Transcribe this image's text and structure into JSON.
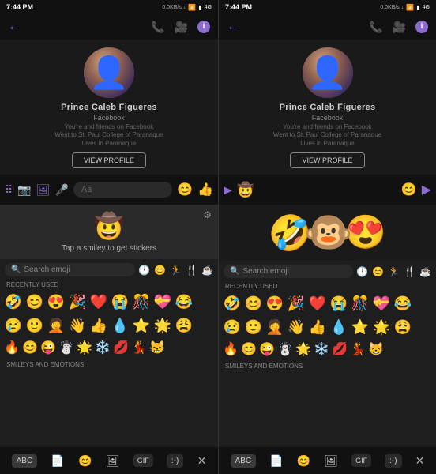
{
  "panels": [
    {
      "id": "left",
      "status_bar": {
        "time": "7:44 PM",
        "signal": "📶",
        "wifi": "WiFi",
        "battery": "4G",
        "data_speed": "0.0KB/s ↓"
      },
      "profile": {
        "name": "Prince Caleb Figueres",
        "source": "Facebook",
        "info_line1": "You're and friends on Facebook",
        "info_line2": "Went to St. Paul College of Paranaque",
        "info_line3": "Lives in Paranaque",
        "view_profile_label": "VIEW PROFILE"
      },
      "toolbar": {
        "placeholder": "Aa"
      },
      "sticker": {
        "text": "Tap a smiley to get stickers"
      },
      "emoji_keyboard": {
        "search_placeholder": "Search emoji",
        "recently_used_label": "RECENTLY USED",
        "emojis_row1": [
          "🤣",
          "😊",
          "😍",
          "🎉",
          "❤",
          "😭"
        ],
        "emojis_row2": [
          "😢",
          "🙂",
          "🤦",
          "👋",
          "👍",
          "💧"
        ],
        "emojis_row3": [
          "🔥",
          "😊",
          "😜",
          "☃",
          "🌟",
          "❄",
          "💋"
        ],
        "keyboard_buttons": [
          "ABC",
          "📄",
          "😊",
          "🖼",
          "GIF",
          ":-)",
          "✕"
        ]
      }
    },
    {
      "id": "right",
      "status_bar": {
        "time": "7:44 PM",
        "data_speed": "0.0KB/s ↓"
      },
      "profile": {
        "name": "Prince Caleb Figueres",
        "source": "Facebook",
        "info_line1": "You're and friends on Facebook",
        "info_line2": "Went to St. Paul College of Paranaque",
        "info_line3": "Lives in Paranaque",
        "view_profile_label": "VIEW PROFILE"
      },
      "big_emojis": [
        "🤣",
        "🐵",
        "😍"
      ],
      "emoji_keyboard": {
        "search_placeholder": "Search emoji",
        "recently_used_label": "RECENTLY USED",
        "emojis_row1": [
          "🤣",
          "😊",
          "😍",
          "🎉",
          "❤",
          "😭"
        ],
        "emojis_row2": [
          "😢",
          "🙂",
          "🤦",
          "👋",
          "👍",
          "💧"
        ],
        "emojis_row3": [
          "🔥",
          "😊",
          "😜",
          "☃",
          "🌟",
          "❄",
          "💋"
        ],
        "keyboard_buttons": [
          "ABC",
          "📄",
          "😊",
          "🖼",
          "GIF",
          ":-)",
          "✕"
        ]
      }
    }
  ],
  "nav": {
    "back": "◀",
    "home": "⬤",
    "square": "■"
  },
  "colors": {
    "accent": "#8b6bce",
    "background": "#1a1a1a",
    "dark": "#111111",
    "text_primary": "#ffffff",
    "text_secondary": "#aaaaaa"
  }
}
